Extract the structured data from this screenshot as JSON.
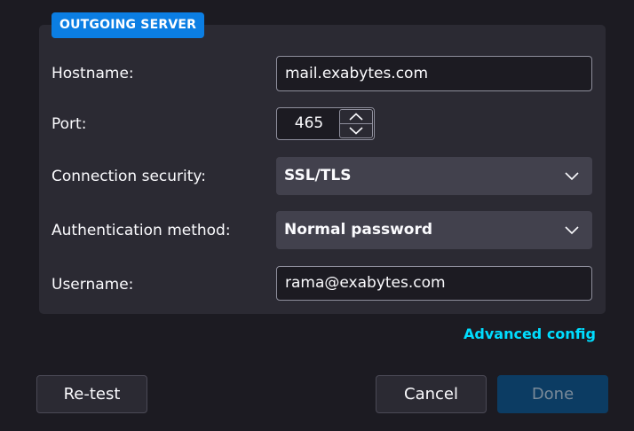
{
  "section": {
    "title": "OUTGOING SERVER"
  },
  "fields": {
    "hostname": {
      "label": "Hostname:",
      "value": "mail.exabytes.com"
    },
    "port": {
      "label": "Port:",
      "value": "465"
    },
    "connection_security": {
      "label": "Connection security:",
      "selected": "SSL/TLS"
    },
    "auth_method": {
      "label": "Authentication method:",
      "selected": "Normal password"
    },
    "username": {
      "label": "Username:",
      "value": "rama@exabytes.com"
    }
  },
  "links": {
    "advanced_config": "Advanced config"
  },
  "buttons": {
    "retest": "Re-test",
    "cancel": "Cancel",
    "done": "Done"
  },
  "colors": {
    "background": "#1c1b22",
    "panel": "#2b2a33",
    "accent": "#0b7ee3",
    "link": "#00ddff",
    "done_disabled": "#0c3c63"
  },
  "icons": {
    "select_arrow": "chevron-down-icon",
    "port_up": "chevron-up-icon",
    "port_down": "chevron-down-icon"
  }
}
